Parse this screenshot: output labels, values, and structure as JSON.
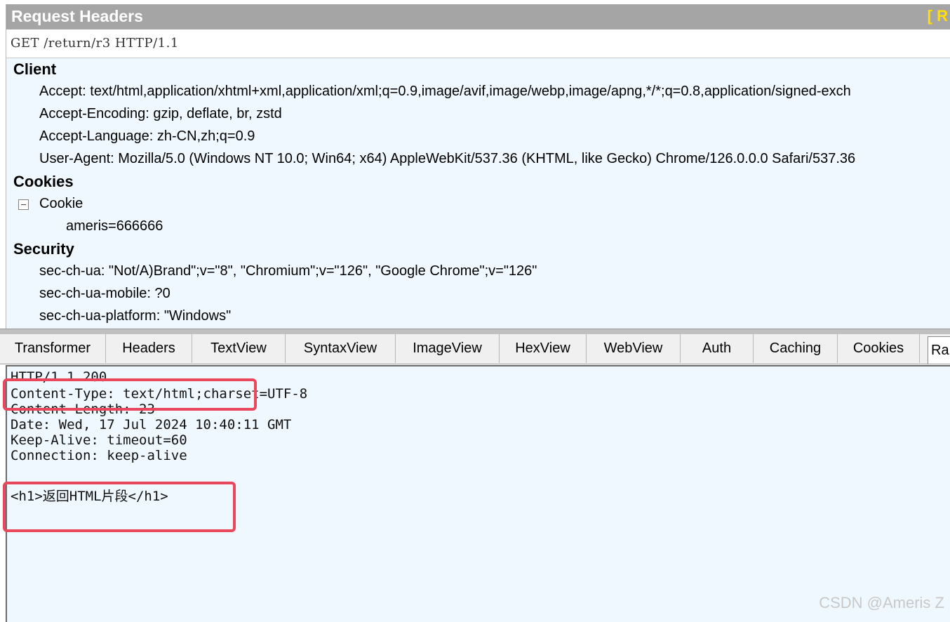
{
  "request_panel": {
    "title": "Request Headers",
    "title_extra": "[ R",
    "request_line": "GET /return/r3 HTTP/1.1",
    "sections": {
      "client": {
        "label": "Client",
        "headers": [
          "Accept: text/html,application/xhtml+xml,application/xml;q=0.9,image/avif,image/webp,image/apng,*/*;q=0.8,application/signed-exch",
          "Accept-Encoding: gzip, deflate, br, zstd",
          "Accept-Language: zh-CN,zh;q=0.9",
          "User-Agent: Mozilla/5.0 (Windows NT 10.0; Win64; x64) AppleWebKit/537.36 (KHTML, like Gecko) Chrome/126.0.0.0 Safari/537.36"
        ]
      },
      "cookies": {
        "label": "Cookies",
        "node_label": "Cookie",
        "values": [
          "ameris=666666"
        ]
      },
      "security": {
        "label": "Security",
        "headers": [
          "sec-ch-ua: \"Not/A)Brand\";v=\"8\", \"Chromium\";v=\"126\", \"Google Chrome\";v=\"126\"",
          "sec-ch-ua-mobile: ?0",
          "sec-ch-ua-platform: \"Windows\""
        ]
      }
    }
  },
  "response_tabs": [
    "Transformer",
    "Headers",
    "TextView",
    "SyntaxView",
    "ImageView",
    "HexView",
    "WebView",
    "Auth",
    "Caching",
    "Cookies",
    "Ra"
  ],
  "active_tab": "Ra",
  "raw_response": {
    "lines": [
      "HTTP/1.1 200",
      "Content-Type: text/html;charset=UTF-8",
      "Content-Length: 23",
      "Date: Wed, 17 Jul 2024 10:40:11 GMT",
      "Keep-Alive: timeout=60",
      "Connection: keep-alive",
      "",
      "<h1>返回HTML片段</h1>"
    ]
  },
  "annotation_color": "#e8475c",
  "watermark": "CSDN @Ameris Z"
}
